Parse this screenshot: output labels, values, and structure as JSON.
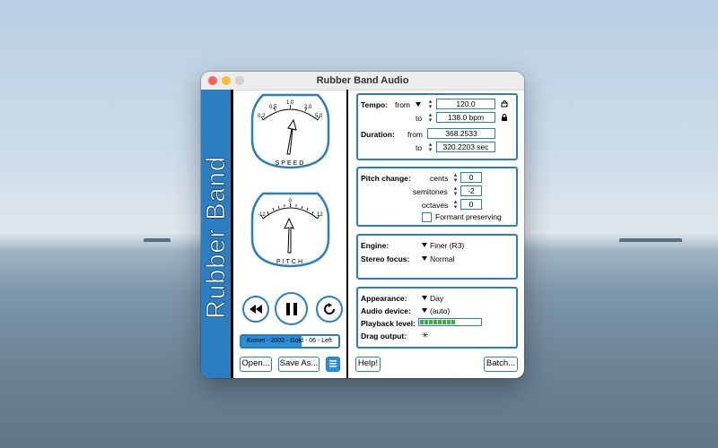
{
  "window": {
    "title": "Rubber Band Audio"
  },
  "sidebar": {
    "logo_text": "Rubber Band"
  },
  "meters": {
    "speed": {
      "label": "SPEED",
      "ticks": [
        "0.2",
        "0.5",
        "1.0",
        "2.0",
        "5.0"
      ]
    },
    "pitch": {
      "label": "PITCH",
      "ticks": [
        "-12",
        "0",
        "12"
      ]
    }
  },
  "transport": {
    "track_label": "Komet - 2003 - Gold - 06 - Left",
    "progress_fraction": 0.62
  },
  "buttons": {
    "open": "Open...",
    "save_as": "Save As...",
    "help": "Help!",
    "batch": "Batch..."
  },
  "tempo": {
    "label": "Tempo:",
    "from_label": "from",
    "from_value": "120.0",
    "to_label": "to",
    "to_value": "138.0 bpm"
  },
  "duration": {
    "label": "Duration:",
    "from_label": "from",
    "from_value": "368.2533",
    "to_label": "to",
    "to_value": "320.2203 sec"
  },
  "pitch_change": {
    "label": "Pitch change:",
    "cents_label": "cents",
    "cents_value": "0",
    "semitones_label": "semitones",
    "semitones_value": "-2",
    "octaves_label": "octaves",
    "octaves_value": "0",
    "formant_label": "Formant preserving"
  },
  "engine": {
    "label": "Engine:",
    "value": "Finer (R3)"
  },
  "stereo": {
    "label": "Stereo focus:",
    "value": "Normal"
  },
  "appearance": {
    "label": "Appearance:",
    "value": "Day"
  },
  "audio_device": {
    "label": "Audio device:",
    "value": "(auto)"
  },
  "playback": {
    "label": "Playback level:",
    "level_fraction": 0.6
  },
  "drag": {
    "label": "Drag output:"
  },
  "colors": {
    "accent": "#2a7ec2",
    "level": "#3ab33a"
  }
}
